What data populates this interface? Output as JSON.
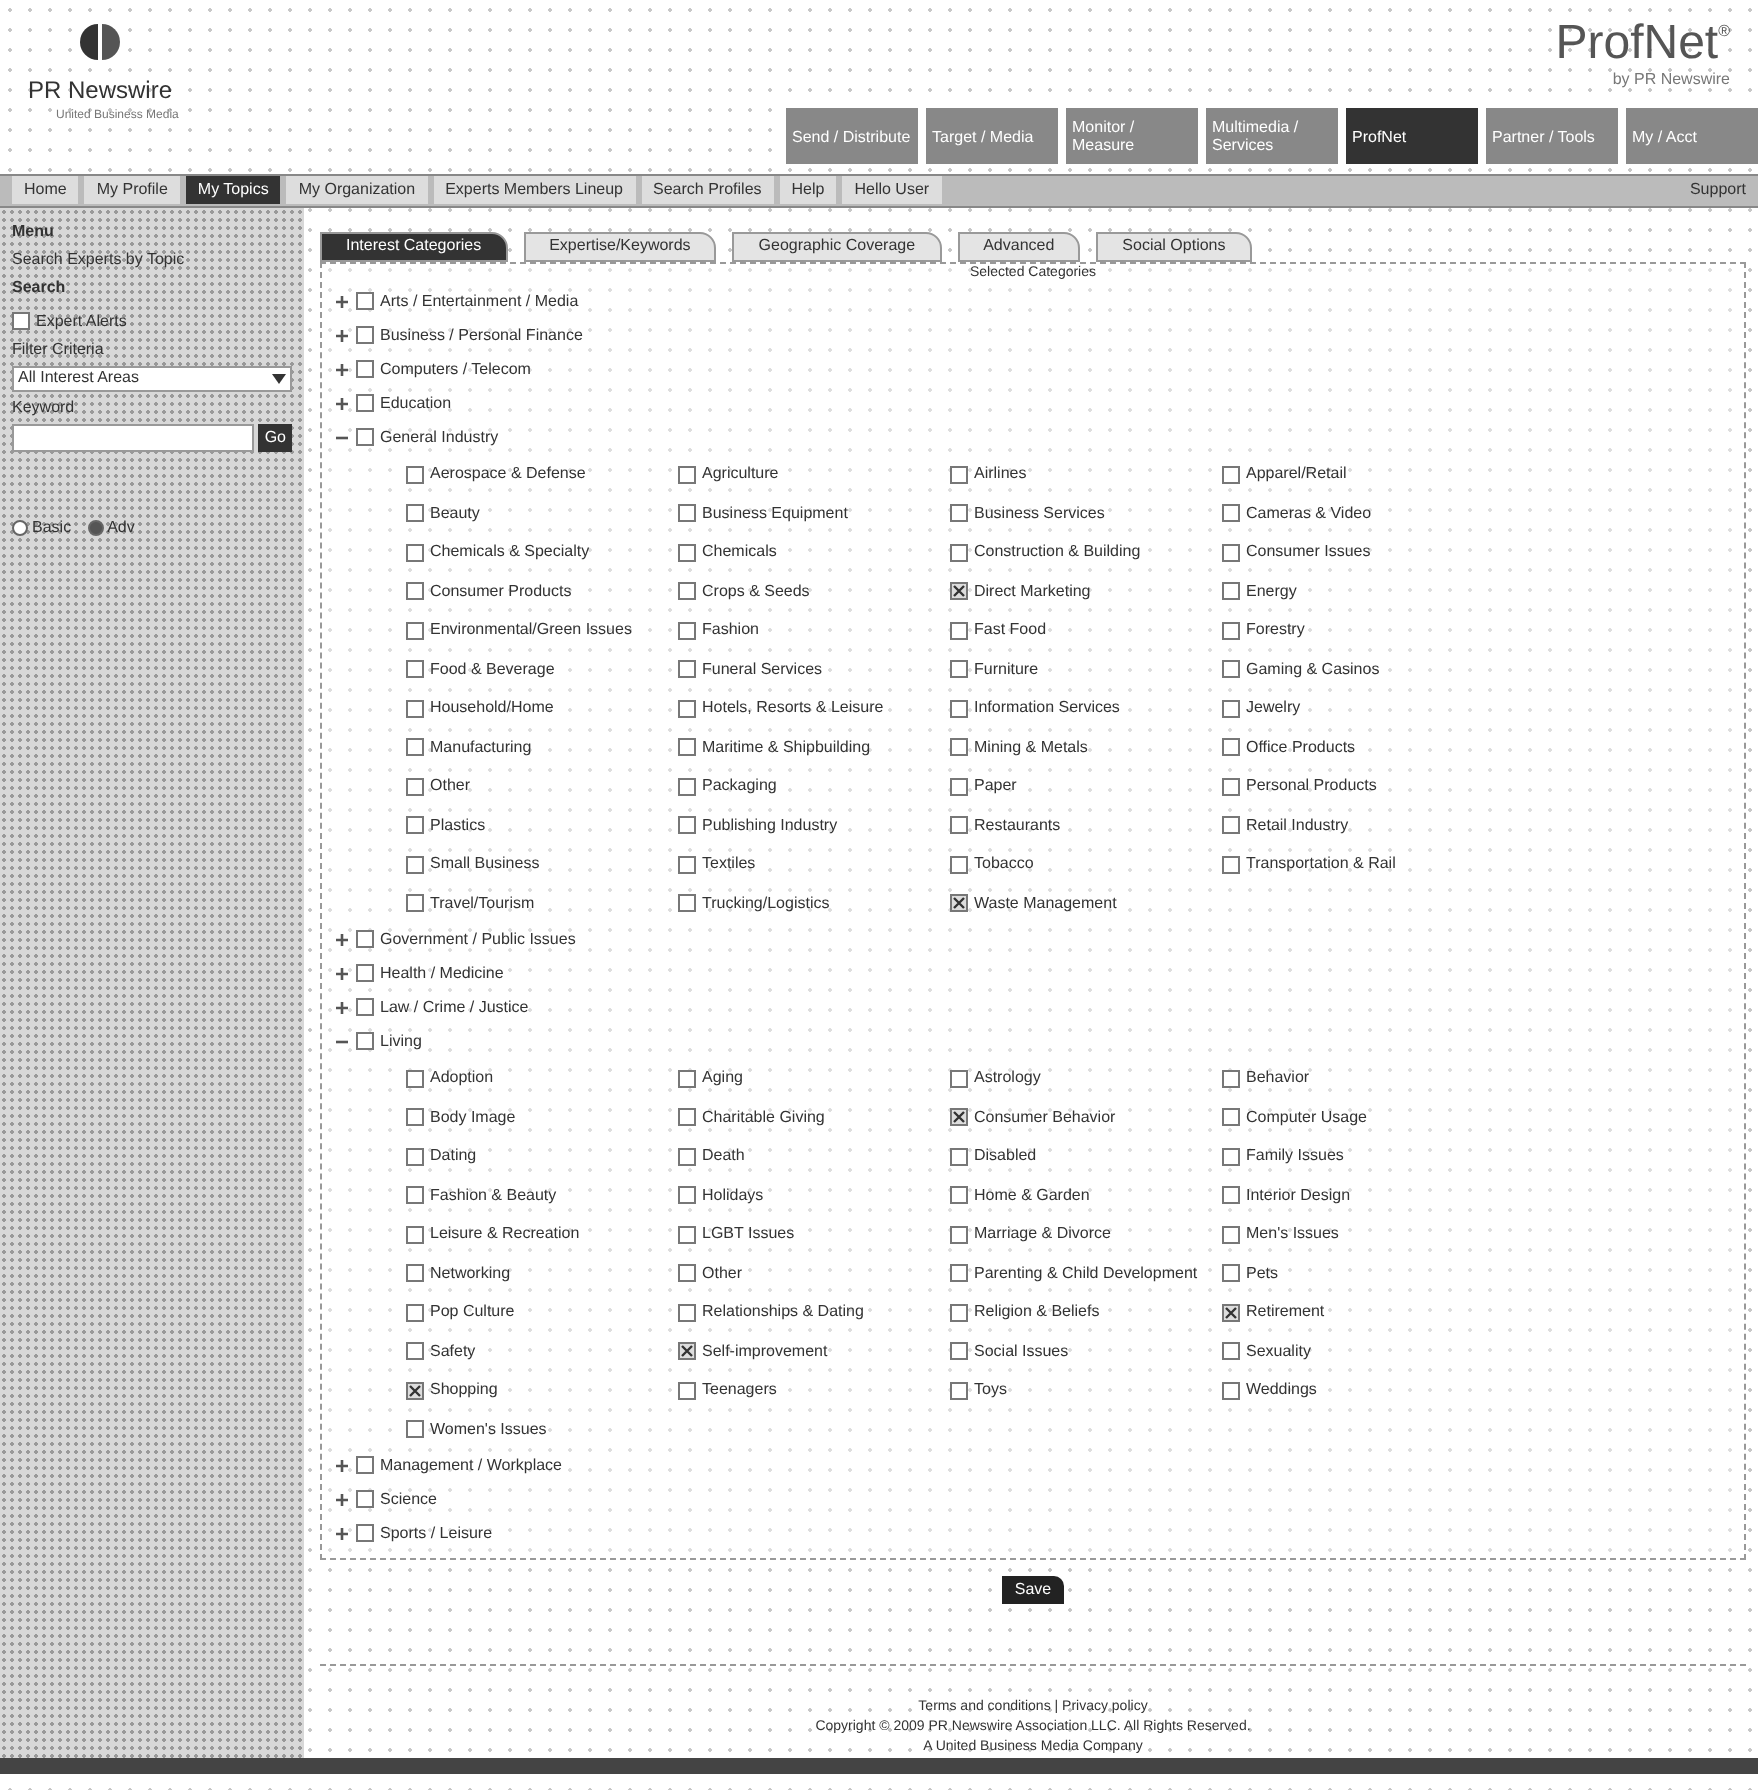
{
  "header": {
    "logo_text": "PR Newswire",
    "logo_tagline": "United Business Media",
    "brand": "ProfNet",
    "brand_mark": "®",
    "brand_tagline": "by PR Newswire",
    "top_tabs": [
      {
        "label": "Send / Distribute",
        "selected": false
      },
      {
        "label": "Target / Media",
        "selected": false
      },
      {
        "label": "Monitor / Measure",
        "selected": false
      },
      {
        "label": "Multimedia / Services",
        "selected": false
      },
      {
        "label": "ProfNet",
        "selected": true
      },
      {
        "label": "Partner / Tools",
        "selected": false
      },
      {
        "label": "My / Acct",
        "selected": false
      }
    ]
  },
  "nav": [
    {
      "label": "Home",
      "selected": false
    },
    {
      "label": "My Profile",
      "selected": false
    },
    {
      "label": "My Topics",
      "selected": true
    },
    {
      "label": "My Organization",
      "selected": false
    },
    {
      "label": "Experts Members Lineup",
      "selected": false
    },
    {
      "label": "Search Profiles",
      "selected": false
    },
    {
      "label": "Help",
      "selected": false
    },
    {
      "label": "Hello User",
      "selected": false
    }
  ],
  "nav_right": "Support",
  "sidebar": {
    "title": "Menu",
    "subtitle": "Search Experts by Topic",
    "section": "Search",
    "alert_option": {
      "label": "Expert Alerts",
      "checked": false
    },
    "filter_label": "Filter Criteria",
    "filter_value": "All Interest Areas",
    "keyword_label": "Keyword",
    "go_button": "Go",
    "modes": [
      {
        "label": "Basic",
        "selected": false
      },
      {
        "label": "Adv",
        "selected": true
      }
    ]
  },
  "tabs": [
    {
      "label": "Interest Categories",
      "selected": true
    },
    {
      "label": "Expertise/Keywords",
      "selected": false
    },
    {
      "label": "Geographic Coverage",
      "selected": false
    },
    {
      "label": "Advanced",
      "selected": false
    },
    {
      "label": "Social Options",
      "selected": false
    }
  ],
  "panel_caption": "Selected Categories",
  "categories": [
    {
      "label": "Arts / Entertainment / Media",
      "checked": false,
      "expanded": false
    },
    {
      "label": "Business / Personal Finance",
      "checked": false,
      "expanded": false
    },
    {
      "label": "Computers / Telecom",
      "checked": false,
      "expanded": false
    },
    {
      "label": "Education",
      "checked": false,
      "expanded": false
    },
    {
      "label": "General Industry",
      "checked": false,
      "expanded": true,
      "children": [
        {
          "label": "Aerospace & Defense",
          "checked": false
        },
        {
          "label": "Agriculture",
          "checked": false
        },
        {
          "label": "Airlines",
          "checked": false
        },
        {
          "label": "Apparel/Retail",
          "checked": false
        },
        {
          "label": "Beauty",
          "checked": false
        },
        {
          "label": "Business Equipment",
          "checked": false
        },
        {
          "label": "Business Services",
          "checked": false
        },
        {
          "label": "Cameras & Video",
          "checked": false
        },
        {
          "label": "Chemicals & Specialty",
          "checked": false
        },
        {
          "label": "Chemicals",
          "checked": false
        },
        {
          "label": "Construction & Building",
          "checked": false
        },
        {
          "label": "Consumer Issues",
          "checked": false
        },
        {
          "label": "Consumer Products",
          "checked": false
        },
        {
          "label": "Crops & Seeds",
          "checked": false
        },
        {
          "label": "Direct Marketing",
          "checked": true
        },
        {
          "label": "Energy",
          "checked": false
        },
        {
          "label": "Environmental/Green Issues",
          "checked": false
        },
        {
          "label": "Fashion",
          "checked": false
        },
        {
          "label": "Fast Food",
          "checked": false
        },
        {
          "label": "Forestry",
          "checked": false
        },
        {
          "label": "Food & Beverage",
          "checked": false
        },
        {
          "label": "Funeral Services",
          "checked": false
        },
        {
          "label": "Furniture",
          "checked": false
        },
        {
          "label": "Gaming & Casinos",
          "checked": false
        },
        {
          "label": "Household/Home",
          "checked": false
        },
        {
          "label": "Hotels, Resorts & Leisure",
          "checked": false
        },
        {
          "label": "Information Services",
          "checked": false
        },
        {
          "label": "Jewelry",
          "checked": false
        },
        {
          "label": "Manufacturing",
          "checked": false
        },
        {
          "label": "Maritime & Shipbuilding",
          "checked": false
        },
        {
          "label": "Mining & Metals",
          "checked": false
        },
        {
          "label": "Office Products",
          "checked": false
        },
        {
          "label": "Other",
          "checked": false
        },
        {
          "label": "Packaging",
          "checked": false
        },
        {
          "label": "Paper",
          "checked": false
        },
        {
          "label": "Personal Products",
          "checked": false
        },
        {
          "label": "Plastics",
          "checked": false
        },
        {
          "label": "Publishing Industry",
          "checked": false
        },
        {
          "label": "Restaurants",
          "checked": false
        },
        {
          "label": "Retail Industry",
          "checked": false
        },
        {
          "label": "Small Business",
          "checked": false
        },
        {
          "label": "Textiles",
          "checked": false
        },
        {
          "label": "Tobacco",
          "checked": false
        },
        {
          "label": "Transportation & Rail",
          "checked": false
        },
        {
          "label": "Travel/Tourism",
          "checked": false
        },
        {
          "label": "Trucking/Logistics",
          "checked": false
        },
        {
          "label": "Waste Management",
          "checked": true
        }
      ]
    },
    {
      "label": "Government / Public Issues",
      "checked": false,
      "expanded": false
    },
    {
      "label": "Health / Medicine",
      "checked": false,
      "expanded": false
    },
    {
      "label": "Law / Crime / Justice",
      "checked": false,
      "expanded": false
    },
    {
      "label": "Living",
      "checked": false,
      "expanded": true,
      "children": [
        {
          "label": "Adoption",
          "checked": false
        },
        {
          "label": "Aging",
          "checked": false
        },
        {
          "label": "Astrology",
          "checked": false
        },
        {
          "label": "Behavior",
          "checked": false
        },
        {
          "label": "Body Image",
          "checked": false
        },
        {
          "label": "Charitable Giving",
          "checked": false
        },
        {
          "label": "Consumer Behavior",
          "checked": true
        },
        {
          "label": "Computer Usage",
          "checked": false
        },
        {
          "label": "Dating",
          "checked": false
        },
        {
          "label": "Death",
          "checked": false
        },
        {
          "label": "Disabled",
          "checked": false
        },
        {
          "label": "Family Issues",
          "checked": false
        },
        {
          "label": "Fashion & Beauty",
          "checked": false
        },
        {
          "label": "Holidays",
          "checked": false
        },
        {
          "label": "Home & Garden",
          "checked": false
        },
        {
          "label": "Interior Design",
          "checked": false
        },
        {
          "label": "Leisure & Recreation",
          "checked": false
        },
        {
          "label": "LGBT Issues",
          "checked": false
        },
        {
          "label": "Marriage & Divorce",
          "checked": false
        },
        {
          "label": "Men's Issues",
          "checked": false
        },
        {
          "label": "Networking",
          "checked": false
        },
        {
          "label": "Other",
          "checked": false
        },
        {
          "label": "Parenting & Child Development",
          "checked": false
        },
        {
          "label": "Pets",
          "checked": false
        },
        {
          "label": "Pop Culture",
          "checked": false
        },
        {
          "label": "Relationships & Dating",
          "checked": false
        },
        {
          "label": "Religion & Beliefs",
          "checked": false
        },
        {
          "label": "Retirement",
          "checked": true
        },
        {
          "label": "Safety",
          "checked": false
        },
        {
          "label": "Self-improvement",
          "checked": true
        },
        {
          "label": "Social Issues",
          "checked": false
        },
        {
          "label": "Sexuality",
          "checked": false
        },
        {
          "label": "Shopping",
          "checked": true
        },
        {
          "label": "Teenagers",
          "checked": false
        },
        {
          "label": "Toys",
          "checked": false
        },
        {
          "label": "Weddings",
          "checked": false
        },
        {
          "label": "Women's Issues",
          "checked": false
        }
      ]
    },
    {
      "label": "Management / Workplace",
      "checked": false,
      "expanded": false
    },
    {
      "label": "Science",
      "checked": false,
      "expanded": false
    },
    {
      "label": "Sports / Leisure",
      "checked": false,
      "expanded": false
    }
  ],
  "save_button": "Save",
  "footer": [
    "Terms and conditions | Privacy policy",
    "Copyright © 2009 PR Newswire Association LLC. All Rights Reserved.",
    "A United Business Media Company"
  ]
}
